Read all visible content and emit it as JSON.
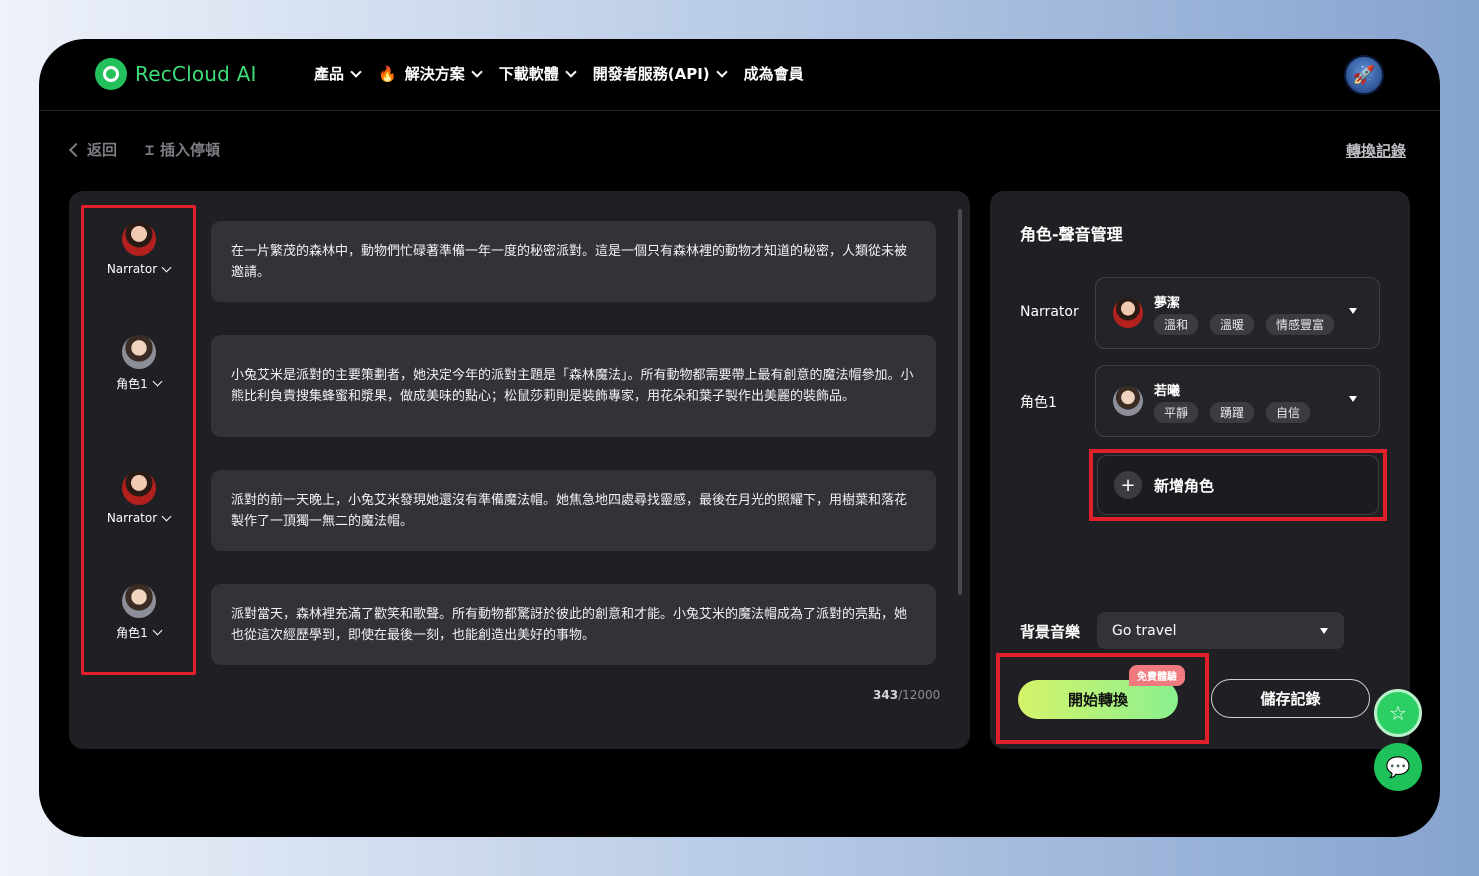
{
  "brand": {
    "name": "RecCloud AI",
    "accent": "#3fdc7a"
  },
  "nav": {
    "items": [
      {
        "label": "產品",
        "has_dropdown": true
      },
      {
        "label": "解決方案",
        "has_dropdown": true
      },
      {
        "label": "下載軟體",
        "has_dropdown": true
      },
      {
        "label": "開發者服務(API)",
        "has_dropdown": true
      },
      {
        "label": "成為會員",
        "has_dropdown": false
      }
    ],
    "fire_icon": "🔥",
    "avatar_icon": "🚀"
  },
  "toolbar": {
    "back_label": "返回",
    "insert_pause_label": "插入停頓",
    "history_label": "轉換記錄"
  },
  "script": {
    "roles": [
      {
        "label": "Narrator",
        "avatar": "red"
      },
      {
        "label": "角色1",
        "avatar": "gray"
      },
      {
        "label": "Narrator",
        "avatar": "red"
      },
      {
        "label": "角色1",
        "avatar": "gray"
      }
    ],
    "paragraphs": [
      "在一片繁茂的森林中，動物們忙碌著準備一年一度的秘密派對。這是一個只有森林裡的動物才知道的秘密，人類從未被邀請。",
      "小兔艾米是派對的主要策劃者，她決定今年的派對主題是「森林魔法」。所有動物都需要帶上最有創意的魔法帽參加。小熊比利負責搜集蜂蜜和漿果，做成美味的點心；松鼠莎莉則是裝飾專家，用花朵和葉子製作出美麗的裝飾品。",
      "派對的前一天晚上，小兔艾米發現她還沒有準備魔法帽。她焦急地四處尋找靈感，最後在月光的照耀下，用樹葉和落花製作了一頂獨一無二的魔法帽。",
      "派對當天，森林裡充滿了歡笑和歌聲。所有動物都驚訝於彼此的創意和才能。小兔艾米的魔法帽成為了派對的亮點，她也從這次經歷學到，即使在最後一刻，也能創造出美好的事物。"
    ],
    "char_count": "343",
    "char_limit": "/12000"
  },
  "voice_panel": {
    "title": "角色-聲音管理",
    "voices": [
      {
        "role": "Narrator",
        "voice_name": "夢潔",
        "tags": [
          "溫和",
          "溫暖",
          "情感豐富"
        ],
        "avatar": "red"
      },
      {
        "role": "角色1",
        "voice_name": "若曦",
        "tags": [
          "平靜",
          "踴躍",
          "自信"
        ],
        "avatar": "gray"
      }
    ],
    "add_role_label": "新增角色",
    "bgm_label": "背景音樂",
    "bgm_value": "Go travel",
    "start_label": "開始轉換",
    "free_badge": "免費體驗",
    "save_label": "儲存記錄"
  },
  "colors": {
    "highlight_red": "#e0202b",
    "start_gradient_from": "#d6f36a",
    "start_gradient_to": "#8af08f"
  }
}
